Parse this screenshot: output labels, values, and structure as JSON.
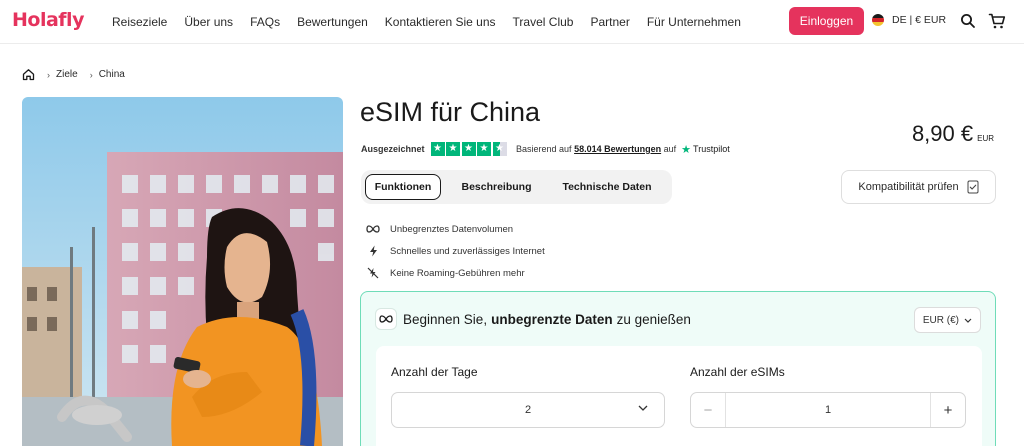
{
  "header": {
    "logo": "Holafly",
    "nav": [
      "Reiseziele",
      "Über uns",
      "FAQs",
      "Bewertungen",
      "Kontaktieren Sie uns",
      "Travel Club",
      "Partner",
      "Für Unternehmen"
    ],
    "login_label": "Einloggen",
    "lang_label": "DE | € EUR"
  },
  "breadcrumb": {
    "items": [
      "Ziele",
      "China"
    ]
  },
  "product": {
    "title": "eSIM für China",
    "rating_label": "Ausgezeichnet",
    "rating_prefix": "Basierend auf",
    "rating_count": "58.014 Bewertungen",
    "rating_suffix": "auf",
    "trustpilot": "Trustpilot",
    "price": "8,90 €",
    "currency": "EUR",
    "tabs": [
      "Funktionen",
      "Beschreibung",
      "Technische Daten"
    ],
    "compat_label": "Kompatibilität prüfen",
    "features": [
      "Unbegrenztes Datenvolumen",
      "Schnelles und zuverlässiges Internet",
      "Keine Roaming-Gebühren mehr"
    ]
  },
  "plan": {
    "heading_pre": "Beginnen Sie,",
    "heading_bold": "unbegrenzte Daten",
    "heading_post": "zu genießen",
    "currency_select": "EUR (€)",
    "days_label": "Anzahl der Tage",
    "days_value": "2",
    "esims_label": "Anzahl der eSIMs",
    "esims_value": "1",
    "minus": "−",
    "plus": "+"
  },
  "colors": {
    "brand": "#e5335d",
    "trustpilot": "#00b67a",
    "card_bg": "#effcf8",
    "card_border": "#6fdcb8"
  },
  "icons": [
    "home-icon",
    "search-icon",
    "cart-icon",
    "infinity-icon",
    "bolt-icon",
    "no-roaming-icon",
    "chevron-down-icon",
    "checklist-icon",
    "trustpilot-star-icon"
  ]
}
